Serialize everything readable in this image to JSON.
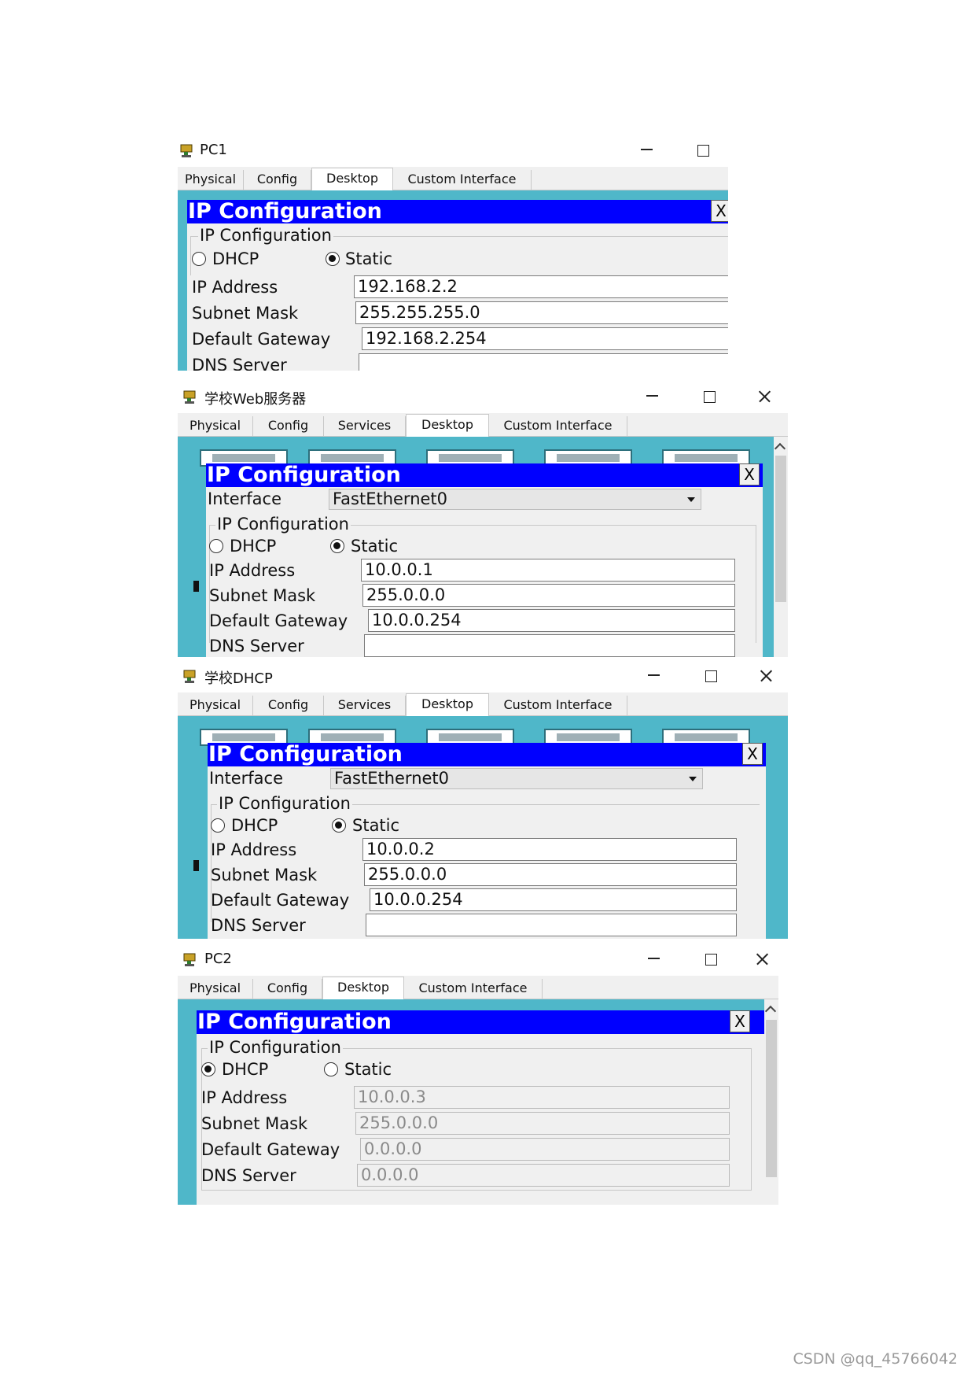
{
  "windows": [
    {
      "title": "PC1",
      "tabs": [
        "Physical",
        "Config",
        "Desktop",
        "Custom Interface"
      ],
      "active_tab": "Desktop",
      "panel_title": "IP Configuration",
      "close_label": "X",
      "group_label": "IP Configuration",
      "dhcp_label": "DHCP",
      "static_label": "Static",
      "mode": "Static",
      "ip_label": "IP Address",
      "ip": "192.168.2.2",
      "mask_label": "Subnet Mask",
      "mask": "255.255.255.0",
      "gateway_label": "Default Gateway",
      "gateway": "192.168.2.254",
      "dns_label": "DNS Server"
    },
    {
      "title": "学校Web服务器",
      "tabs": [
        "Physical",
        "Config",
        "Services",
        "Desktop",
        "Custom Interface"
      ],
      "active_tab": "Desktop",
      "panel_title": "IP Configuration",
      "close_label": "X",
      "interface_label": "Interface",
      "interface_value": "FastEthernet0",
      "group_label": "IP Configuration",
      "dhcp_label": "DHCP",
      "static_label": "Static",
      "mode": "Static",
      "ip_label": "IP Address",
      "ip": "10.0.0.1",
      "mask_label": "Subnet Mask",
      "mask": "255.0.0.0",
      "gateway_label": "Default Gateway",
      "gateway": "10.0.0.254",
      "dns_label": "DNS Server"
    },
    {
      "title": "学校DHCP",
      "tabs": [
        "Physical",
        "Config",
        "Services",
        "Desktop",
        "Custom Interface"
      ],
      "active_tab": "Desktop",
      "panel_title": "IP Configuration",
      "close_label": "X",
      "interface_label": "Interface",
      "interface_value": "FastEthernet0",
      "group_label": "IP Configuration",
      "dhcp_label": "DHCP",
      "static_label": "Static",
      "mode": "Static",
      "ip_label": "IP Address",
      "ip": "10.0.0.2",
      "mask_label": "Subnet Mask",
      "mask": "255.0.0.0",
      "gateway_label": "Default Gateway",
      "gateway": "10.0.0.254",
      "dns_label": "DNS Server"
    },
    {
      "title": "PC2",
      "tabs": [
        "Physical",
        "Config",
        "Desktop",
        "Custom Interface"
      ],
      "active_tab": "Desktop",
      "panel_title": "IP Configuration",
      "close_label": "X",
      "group_label": "IP Configuration",
      "dhcp_label": "DHCP",
      "static_label": "Static",
      "mode": "DHCP",
      "ip_label": "IP Address",
      "ip": "10.0.0.3",
      "mask_label": "Subnet Mask",
      "mask": "255.0.0.0",
      "gateway_label": "Default Gateway",
      "gateway": "0.0.0.0",
      "dns_label": "DNS Server",
      "dns": "0.0.0.0"
    }
  ],
  "watermark": "CSDN @qq_45766042",
  "colors": {
    "title_bar_blue": "#0000ff",
    "desktop_teal": "#4fb7c9",
    "panel_gray": "#f0f0f0"
  },
  "icons": {
    "app": "packet-tracer-device-icon",
    "minimize": "minimize-icon",
    "maximize": "maximize-icon",
    "close": "close-icon"
  }
}
